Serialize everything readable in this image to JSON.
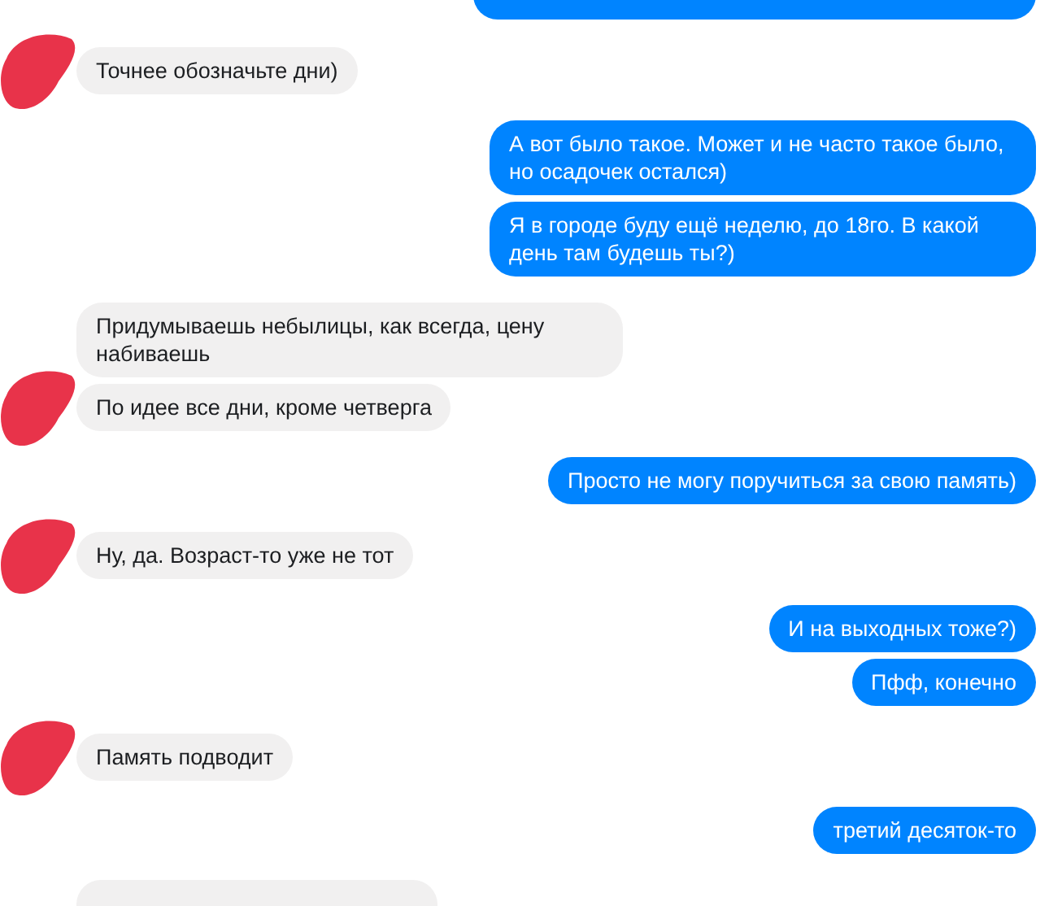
{
  "partial_top": {
    "outgoing": true
  },
  "groups": [
    {
      "outgoing": false,
      "messages": [
        {
          "text": "Точнее обозначьте дни)"
        }
      ]
    },
    {
      "outgoing": true,
      "messages": [
        {
          "text": "А вот было такое. Может и не часто такое было, но осадочек остался)"
        },
        {
          "text": "Я в городе буду ещё неделю, до 18го. В какой день там будешь ты?)"
        }
      ]
    },
    {
      "outgoing": false,
      "messages": [
        {
          "text": "Придумываешь небылицы, как всегда, цену набиваешь"
        },
        {
          "text": "По идее все дни, кроме четверга"
        }
      ]
    },
    {
      "outgoing": true,
      "messages": [
        {
          "text": "Просто не могу поручиться за свою память)"
        }
      ]
    },
    {
      "outgoing": false,
      "messages": [
        {
          "text": "Ну, да. Возраст-то уже не тот"
        }
      ]
    },
    {
      "outgoing": true,
      "messages": [
        {
          "text": "И на выходных тоже?)"
        },
        {
          "text": "Пфф, конечно"
        }
      ]
    },
    {
      "outgoing": false,
      "messages": [
        {
          "text": "Память подводит"
        }
      ]
    },
    {
      "outgoing": true,
      "messages": [
        {
          "text": "третий десяток-то"
        }
      ]
    }
  ],
  "partial_bottom": {
    "outgoing": false
  }
}
